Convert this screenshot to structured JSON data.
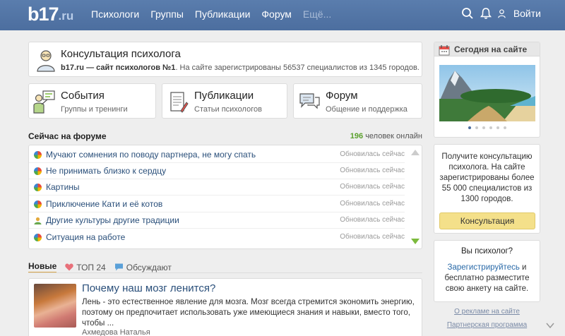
{
  "header": {
    "logo_main": "b17",
    "logo_suffix": ".ru",
    "nav": [
      "Психологи",
      "Группы",
      "Публикации",
      "Форум"
    ],
    "nav_more": "Ещё...",
    "login_label": "Войти",
    "icons": [
      "search-icon",
      "bell-icon",
      "user-icon"
    ]
  },
  "consult": {
    "title": "Консультация психолога",
    "site_bold": "b17.ru — сайт психологов №1",
    "description": ". На сайте зарегистрированы 56537 специалистов из 1345 городов."
  },
  "tiles": [
    {
      "title": "События",
      "subtitle": "Группы и тренинги",
      "icon": "presenter-icon"
    },
    {
      "title": "Публикации",
      "subtitle": "Статьи психологов",
      "icon": "document-icon"
    },
    {
      "title": "Форум",
      "subtitle": "Общение и поддержка",
      "icon": "chat-icon"
    }
  ],
  "forum": {
    "title": "Сейчас на форуме",
    "online_count": "196",
    "online_label": "человек онлайн",
    "topics": [
      {
        "title": "Мучают сомнения по поводу партнера, не могу спать",
        "status": "Обновилась сейчас",
        "icon": "color-dot-icon"
      },
      {
        "title": "Не принимать близко к сердцу",
        "status": "Обновилась сейчас",
        "icon": "color-dot-icon"
      },
      {
        "title": "Картины",
        "status": "Обновилась сейчас",
        "icon": "color-dot-icon"
      },
      {
        "title": "Приключение Кати и её котов",
        "status": "Обновилась сейчас",
        "icon": "color-dot-icon"
      },
      {
        "title": "Другие культуры другие традиции",
        "status": "Обновилась сейчас",
        "icon": "person-icon"
      },
      {
        "title": "Ситуация на работе",
        "status": "Обновилась сейчас",
        "icon": "color-dot-icon"
      }
    ]
  },
  "tabs": [
    {
      "label": "Новые",
      "icon": ""
    },
    {
      "label": "ТОП 24",
      "icon": "heart-icon"
    },
    {
      "label": "Обсуждают",
      "icon": "comment-icon"
    }
  ],
  "article": {
    "title": "Почему наш мозг ленится?",
    "text": "Лень - это естественное явление для мозга. Мозг всегда стремится экономить энергию, поэтому он предпочитает использовать уже имеющиеся знания и навыки, вместо того, чтобы ...",
    "author": "Ахмедова Наталья"
  },
  "today": {
    "title": "Сегодня на сайте",
    "slides_total": 6,
    "slide_active": 1
  },
  "promo": {
    "text": "Получите консультацию психолога. На сайте зарегистрированы более 55 000 специалистов из 1300 городов.",
    "button": "Консультация"
  },
  "psych": {
    "question": "Вы психолог?",
    "link": "Зарегистрируйтесь",
    "text": " и бесплатно разместите свою анкету на сайте."
  },
  "footer_links": [
    "О рекламе на сайте",
    "Партнерская программа"
  ],
  "colors": {
    "header_bg": "#4c6e9f",
    "online_green": "#5aa02c",
    "link_blue": "#2a4f7a",
    "button_yellow": "#f4e08a",
    "tab_underline": "#d9a64a"
  }
}
